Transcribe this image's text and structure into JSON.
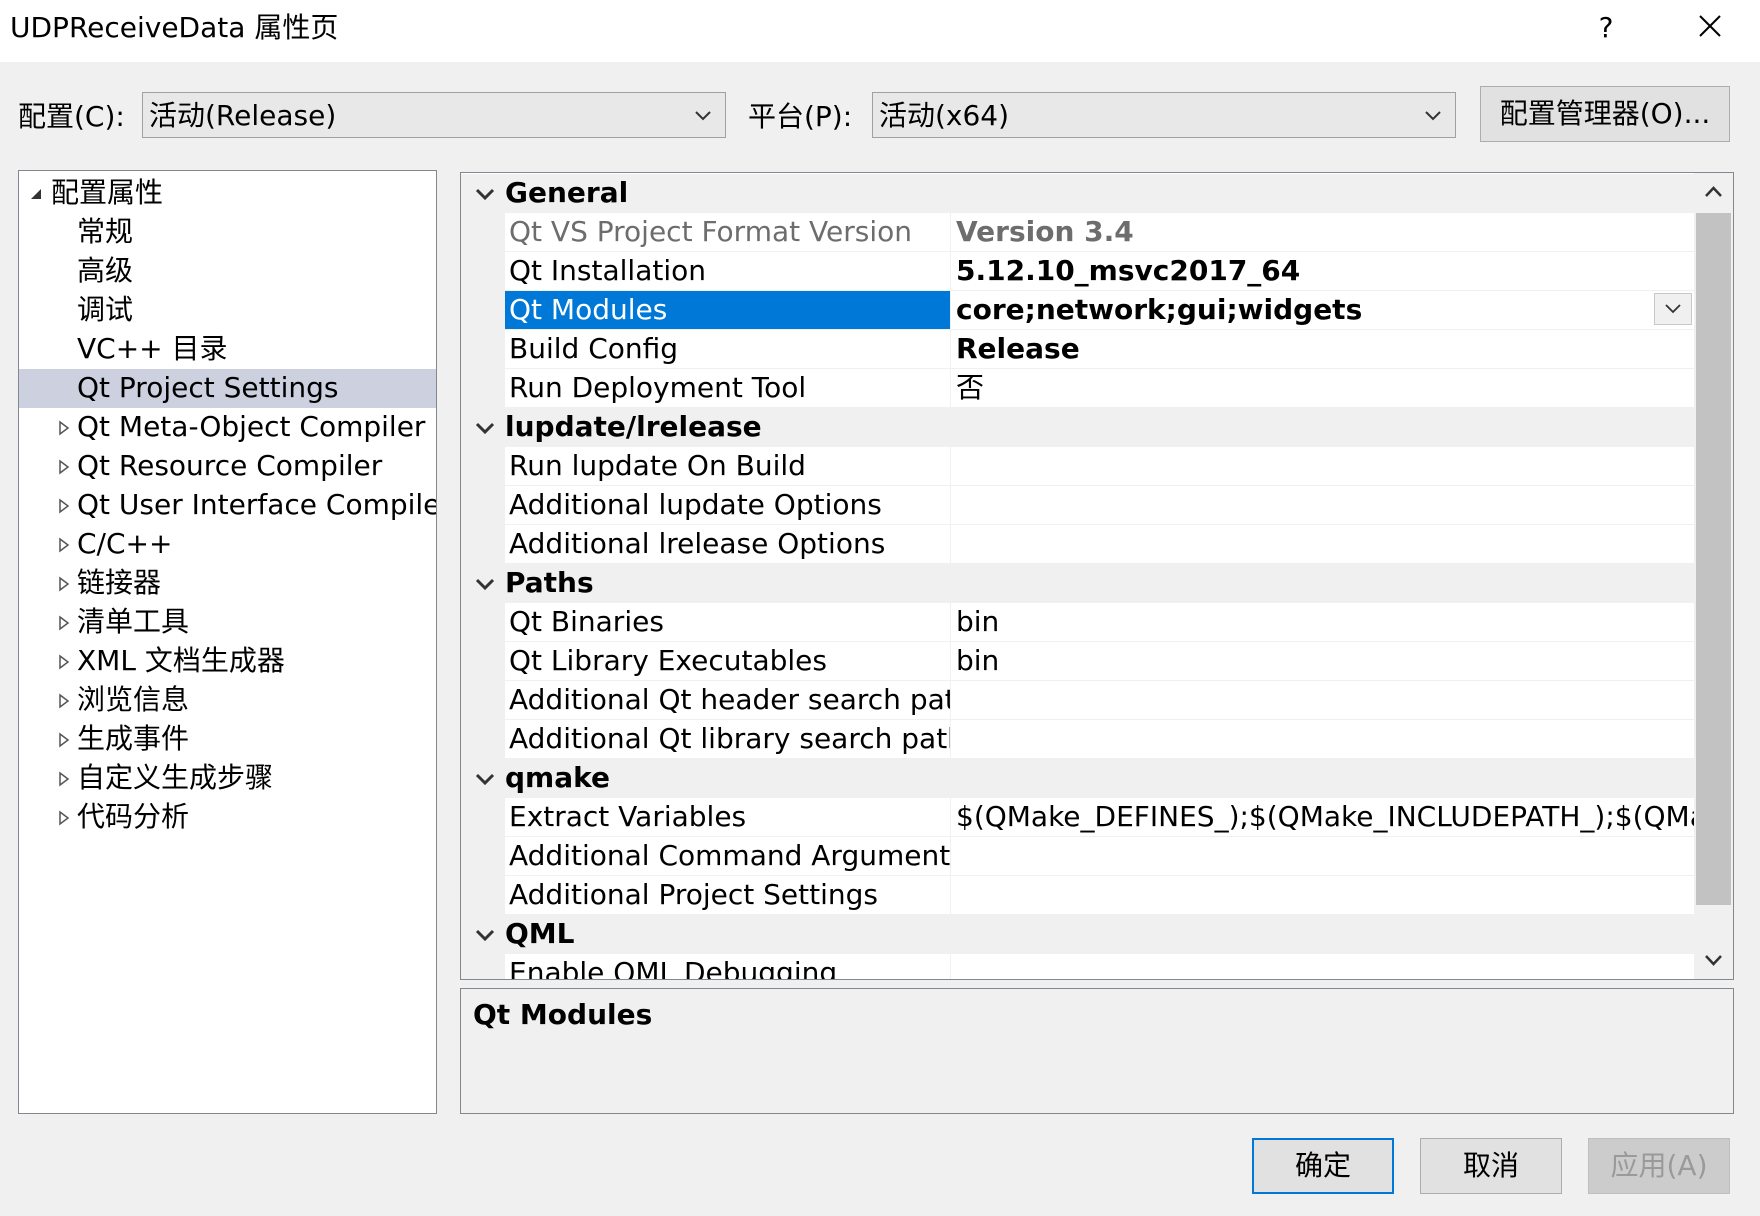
{
  "window": {
    "title": "UDPReceiveData 属性页",
    "help_label": "?",
    "close_icon": "close-icon"
  },
  "toolbar": {
    "config_label": "配置(C):",
    "config_value": "活动(Release)",
    "platform_label": "平台(P):",
    "platform_value": "活动(x64)",
    "config_manager_label": "配置管理器(O)..."
  },
  "tree": {
    "items": [
      {
        "label": "配置属性",
        "expander": "expanded"
      },
      {
        "label": "常规",
        "expander": "none"
      },
      {
        "label": "高级",
        "expander": "none"
      },
      {
        "label": "调试",
        "expander": "none"
      },
      {
        "label": "VC++ 目录",
        "expander": "none"
      },
      {
        "label": "Qt Project Settings",
        "expander": "none",
        "selected": true
      },
      {
        "label": "Qt Meta-Object Compiler",
        "expander": "collapsed"
      },
      {
        "label": "Qt Resource Compiler",
        "expander": "collapsed"
      },
      {
        "label": "Qt User Interface Compiler",
        "expander": "collapsed"
      },
      {
        "label": "C/C++",
        "expander": "collapsed"
      },
      {
        "label": "链接器",
        "expander": "collapsed"
      },
      {
        "label": "清单工具",
        "expander": "collapsed"
      },
      {
        "label": "XML 文档生成器",
        "expander": "collapsed"
      },
      {
        "label": "浏览信息",
        "expander": "collapsed"
      },
      {
        "label": "生成事件",
        "expander": "collapsed"
      },
      {
        "label": "自定义生成步骤",
        "expander": "collapsed"
      },
      {
        "label": "代码分析",
        "expander": "collapsed"
      }
    ]
  },
  "grid": {
    "groups": [
      {
        "name": "General",
        "props": [
          {
            "name": "Qt VS Project Format Version",
            "value": "Version 3.4",
            "name_gray": true,
            "value_gray": true,
            "bold": true
          },
          {
            "name": "Qt Installation",
            "value": "5.12.10_msvc2017_64",
            "bold": true
          },
          {
            "name": "Qt Modules",
            "value": "core;network;gui;widgets",
            "bold": true,
            "selected": true
          },
          {
            "name": "Build Config",
            "value": "Release",
            "bold": true
          },
          {
            "name": "Run Deployment Tool",
            "value": "否"
          }
        ]
      },
      {
        "name": "lupdate/lrelease",
        "props": [
          {
            "name": "Run lupdate On Build",
            "value": ""
          },
          {
            "name": "Additional lupdate Options",
            "value": ""
          },
          {
            "name": "Additional lrelease Options",
            "value": ""
          }
        ]
      },
      {
        "name": "Paths",
        "props": [
          {
            "name": "Qt Binaries",
            "value": "bin"
          },
          {
            "name": "Qt Library Executables",
            "value": "bin"
          },
          {
            "name": "Additional Qt header search paths",
            "value": ""
          },
          {
            "name": "Additional Qt library search paths",
            "value": ""
          }
        ]
      },
      {
        "name": "qmake",
        "props": [
          {
            "name": "Extract Variables",
            "value": "$(QMake_DEFINES_);$(QMake_INCLUDEPATH_);$(QMake_"
          },
          {
            "name": "Additional Command Arguments",
            "value": ""
          },
          {
            "name": "Additional Project Settings",
            "value": ""
          }
        ]
      },
      {
        "name": "QML",
        "props": [
          {
            "name": "Enable QML Debugging",
            "value": ""
          }
        ]
      }
    ]
  },
  "description": {
    "title": "Qt Modules"
  },
  "buttons": {
    "ok": "确定",
    "cancel": "取消",
    "apply": "应用(A)"
  },
  "colors": {
    "selection": "#0078d7",
    "tree_selection": "#cdd0df",
    "dialog_bg": "#f0f0f0"
  }
}
